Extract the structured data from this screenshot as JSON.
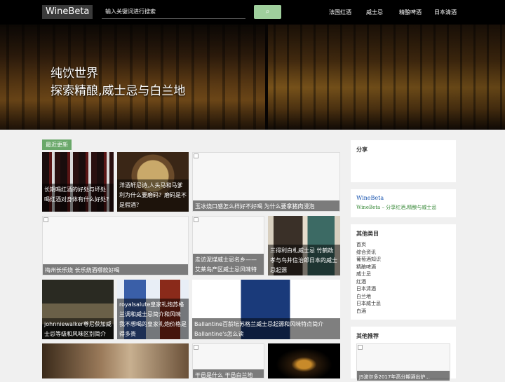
{
  "header": {
    "logo": "WineBeta",
    "search_placeholder": "输入关键词进行搜索",
    "nav": [
      "法国红酒",
      "威士忌",
      "精酿啤酒",
      "日本清酒"
    ]
  },
  "hero": {
    "line1": "纯饮世界",
    "line2": "探索精酿,威士忌与白兰地"
  },
  "section_tag": "最近更新",
  "cards": [
    "长期喝红酒的好处与坏处 喝红酒对身体有什么好处?",
    "洋酒轩尼诗,人头马和马爹利为什么要磨码？磨码是不是假酒？",
    "玉冰烧口感怎么样好不好喝 为什么要拿猪肉浸泡",
    "梅州长乐烧 长乐烧酒哪款好喝",
    "走访泥煤威士忌名乡——艾莱岛产区威士忌风味特点",
    "三得利白札威士忌 竹鹤政孝与鸟井信治郎日本的威士忌起源",
    "johnniewalker尊尼获加威士忌等级和风味区别简介",
    "royalsalute皇家礼炮苏格兰调和威士忌简介和风味 我不想喝的皇家礼炮价格是得多贵",
    "Ballantine百龄坛苏格兰威士忌起源和风味特点简介 Ballantine's怎么读",
    "干邑是什么 干邑白兰地"
  ],
  "sidebar": {
    "share_title": "分享",
    "site_name": "WineBeta",
    "site_desc": "WineBeta – 分享红酒,精酿与威士忌",
    "cats_title": "其他类目",
    "cats": [
      "首页",
      "综合资讯",
      "葡萄酒知识",
      "精酿啤酒",
      "威士忌",
      "红酒",
      "日本清酒",
      "白兰地",
      "日本威士忌",
      "白酒"
    ],
    "rec_title": "其他推荐",
    "rec_caption": "JS波尔多2017年高分期酒出炉..."
  },
  "colors": {
    "accent": "#6aa86a",
    "search_button": "#9fcf9c",
    "link_blue": "#1a55b0",
    "link_green": "#3a8a3a"
  }
}
